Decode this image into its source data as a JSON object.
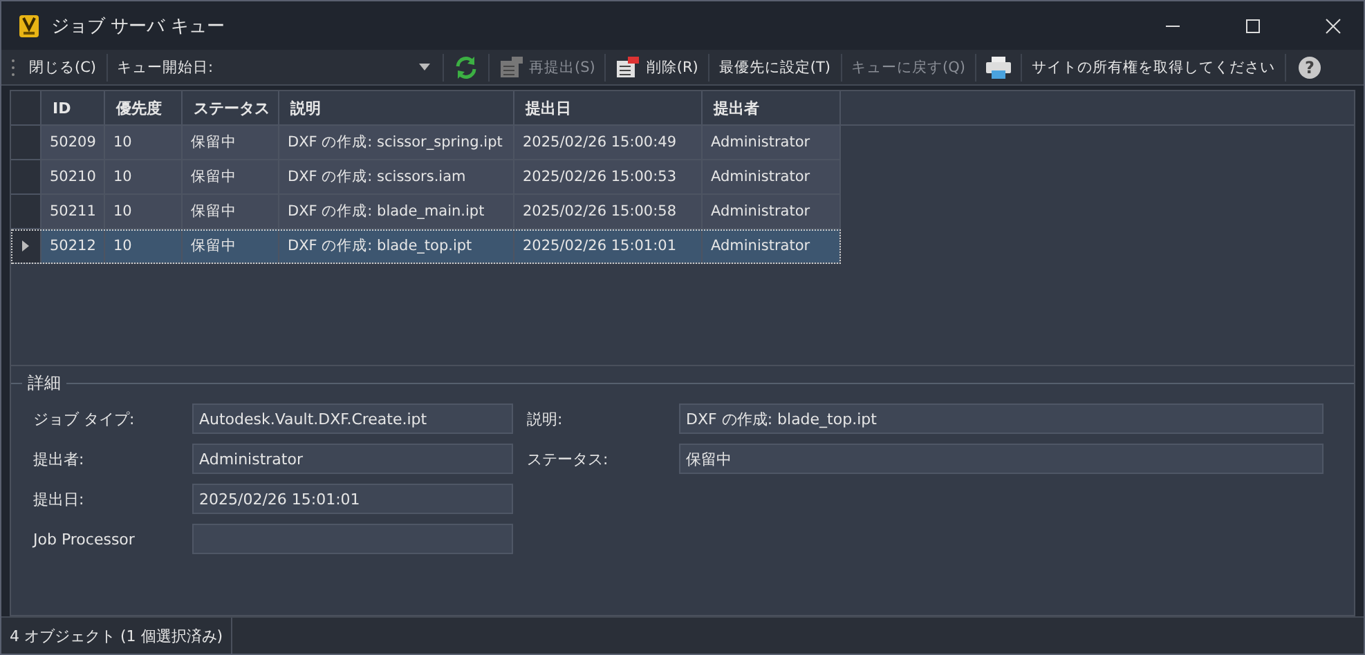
{
  "window": {
    "title": "ジョブ サーバ キュー"
  },
  "toolbar": [
    {
      "kind": "button",
      "label": "閉じる(C)",
      "disabled": false
    },
    {
      "kind": "dropdown",
      "label": "キュー開始日:"
    },
    {
      "kind": "refresh"
    },
    {
      "kind": "button",
      "label": "再提出(S)",
      "disabled": true
    },
    {
      "kind": "button",
      "label": "削除(R)",
      "disabled": false
    },
    {
      "kind": "button",
      "label": "最優先に設定(T)",
      "disabled": false
    },
    {
      "kind": "button",
      "label": "キューに戻す(Q)",
      "disabled": true
    },
    {
      "kind": "print"
    },
    {
      "kind": "button",
      "label": "サイトの所有権を取得してください",
      "disabled": false
    },
    {
      "kind": "help",
      "label": "?"
    }
  ],
  "table": {
    "columns": [
      "ID",
      "優先度",
      "ステータス",
      "説明",
      "提出日",
      "提出者"
    ],
    "rows": [
      {
        "cells": [
          "50209",
          "10",
          "保留中",
          "DXF の作成: scissor_spring.ipt",
          "2025/02/26 15:00:49",
          "Administrator"
        ],
        "selected": false
      },
      {
        "cells": [
          "50210",
          "10",
          "保留中",
          "DXF の作成: scissors.iam",
          "2025/02/26 15:00:53",
          "Administrator"
        ],
        "selected": false
      },
      {
        "cells": [
          "50211",
          "10",
          "保留中",
          "DXF の作成: blade_main.ipt",
          "2025/02/26 15:00:58",
          "Administrator"
        ],
        "selected": false
      },
      {
        "cells": [
          "50212",
          "10",
          "保留中",
          "DXF の作成: blade_top.ipt",
          "2025/02/26 15:01:01",
          "Administrator"
        ],
        "selected": true
      }
    ]
  },
  "details": {
    "title": "詳細",
    "left": [
      {
        "label": "ジョブ タイプ:",
        "value": "Autodesk.Vault.DXF.Create.ipt"
      },
      {
        "label": "提出者:",
        "value": "Administrator"
      },
      {
        "label": "提出日:",
        "value": "2025/02/26 15:01:01"
      },
      {
        "label": "Job Processor"
      }
    ],
    "right": [
      {
        "label": "説明:",
        "value": "DXF の作成: blade_top.ipt"
      },
      {
        "label": "ステータス:",
        "value": "保留中"
      }
    ]
  },
  "status_bar": "4 オブジェクト (1 個選択済み)"
}
